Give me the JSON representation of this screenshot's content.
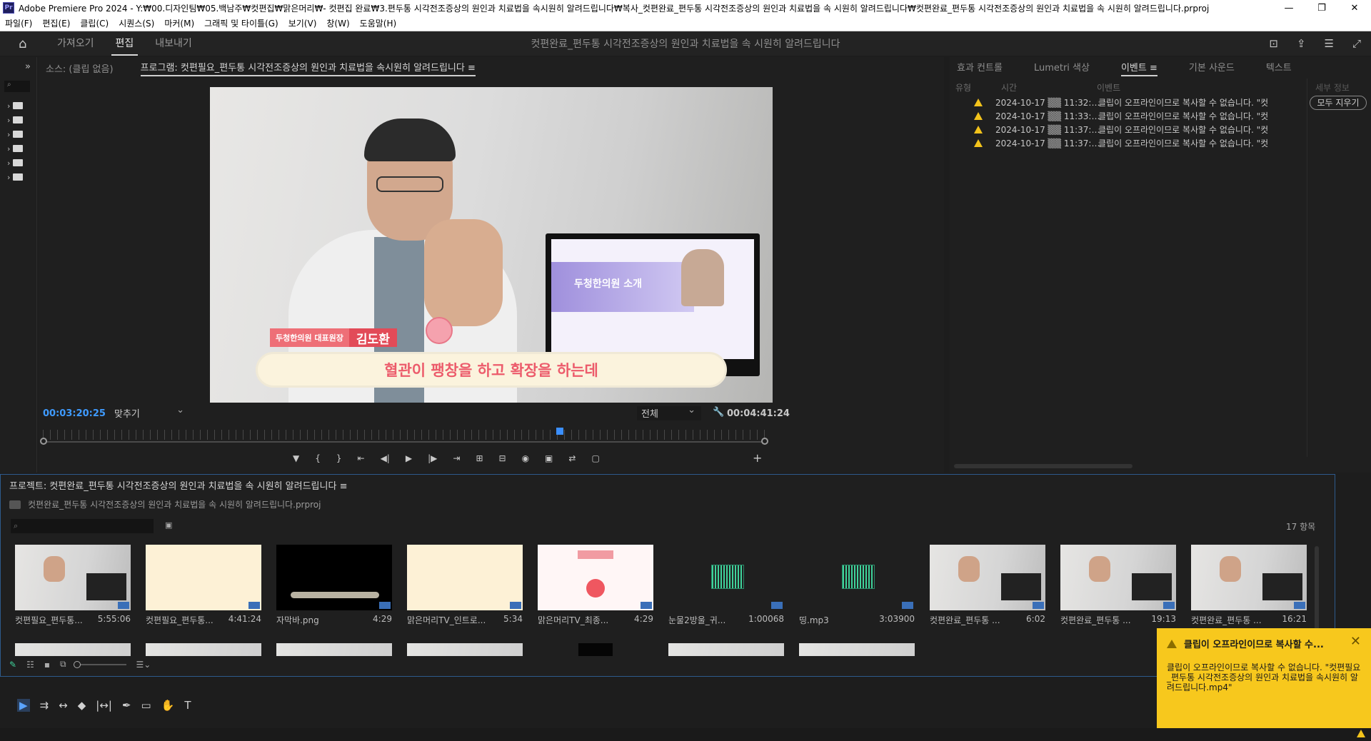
{
  "window": {
    "title": "Adobe Premiere Pro 2024 - Y:₩00.디자인팀₩05.백남주₩컷편집₩맑은머리₩- 컷편집 완료₩3.편두통 시각전조증상의 원인과 치료법을 속시원히 알려드립니다₩복사_컷편완료_편두통 시각전조증상의 원인과 치료법을 속 시원히 알려드립니다₩컷편완료_편두통 시각전조증상의 원인과 치료법을 속 시원히 알려드립니다.prproj",
    "logo": "Pr",
    "controls": [
      "—",
      "❐",
      "✕"
    ]
  },
  "menu": [
    "파일(F)",
    "편집(E)",
    "클립(C)",
    "시퀀스(S)",
    "마커(M)",
    "그래픽 및 타이틀(G)",
    "보기(V)",
    "창(W)",
    "도움말(H)"
  ],
  "workspace": {
    "tabs": [
      "가져오기",
      "편집",
      "내보내기"
    ],
    "active": "편집",
    "title": "컷편완료_편두통 시각전조증상의 원인과 치료법을 속 시원히 알려드립니다"
  },
  "program_monitor": {
    "source_tab": "소스: (클립 없음)",
    "program_tab": "프로그램: 컷편필요_편두통 시각전조증상의 원인과 치료법을 속시원히 알려드립니다",
    "menu_icon": "≡",
    "timecode_current": "00:03:20:25",
    "fit_label": "맞추기",
    "quality_label": "전체",
    "timecode_duration": "00:04:41:24",
    "playhead_fraction": 0.71,
    "video": {
      "lower_third_role": "두청한의원 대표원장",
      "lower_third_name": "김도환",
      "subtitle": "혈관이 팽창을 하고 확장을 하는데",
      "monitor_text": "두청한의원 소개"
    },
    "transport": [
      "▼",
      "{",
      "}",
      "⇤",
      "◀|",
      "▶",
      "|▶",
      "⇥",
      "⊞",
      "⊟",
      "◉",
      "▣",
      "⇄",
      "▢"
    ],
    "add": "+"
  },
  "events_panel": {
    "tabs": [
      "효과 컨트롤",
      "Lumetri 색상",
      "이벤트",
      "기본 사운드",
      "텍스트"
    ],
    "active": "이벤트",
    "col_type": "유형",
    "col_time": "시간",
    "col_event": "이벤트",
    "detail_head": "세부 정보",
    "clear_all": "모두 지우기",
    "rows": [
      {
        "time": "2024-10-17 ▒▒ 11:32:…",
        "msg": "클립이 오프라인이므로 복사할 수 없습니다. \"컷"
      },
      {
        "time": "2024-10-17 ▒▒ 11:33:…",
        "msg": "클립이 오프라인이므로 복사할 수 없습니다. \"컷"
      },
      {
        "time": "2024-10-17 ▒▒ 11:37:…",
        "msg": "클립이 오프라인이므로 복사할 수 없습니다. \"컷"
      },
      {
        "time": "2024-10-17 ▒▒ 11:37:…",
        "msg": "클립이 오프라인이므로 복사할 수 없습니다. \"컷"
      }
    ]
  },
  "project_panel": {
    "title": "프로젝트: 컷편완료_편두통 시각전조증상의 원인과 치료법을 속 시원히 알려드립니다",
    "path": "컷편완료_편두통 시각전조증상의 원인과 치료법을 속 시원히 알려드립니다.prproj",
    "search_placeholder": "",
    "item_count": "17 항목",
    "items": [
      {
        "name": "컷편필요_편두통...",
        "duration": "5:55:06",
        "kind": "video"
      },
      {
        "name": "컷편필요_편두통...",
        "duration": "4:41:24",
        "kind": "cream"
      },
      {
        "name": "자막바.png",
        "duration": "4:29",
        "kind": "black"
      },
      {
        "name": "맑은머리TV_인트로...",
        "duration": "5:34",
        "kind": "cream"
      },
      {
        "name": "맑은머리TV_최종...",
        "duration": "4:29",
        "kind": "pink"
      },
      {
        "name": "눈물2방울_귀...",
        "duration": "1:00068",
        "kind": "audio"
      },
      {
        "name": "띵.mp3",
        "duration": "3:03900",
        "kind": "audio"
      },
      {
        "name": "컷편완료_편두통 ...",
        "duration": "6:02",
        "kind": "video"
      },
      {
        "name": "컷편완료_편두통 ...",
        "duration": "19:13",
        "kind": "video"
      },
      {
        "name": "컷편완료_편두통 ...",
        "duration": "16:21",
        "kind": "video"
      }
    ]
  },
  "tools": [
    "▶",
    "⇉",
    "↔",
    "◆",
    "|↔|",
    "✒",
    "▭",
    "✋",
    "T"
  ],
  "toast": {
    "title": "클립이 오프라인이므로 복사할 수...",
    "close": "✕",
    "body": "클립이 오프라인이므로 복사할 수 없습니다. \"컷편필요_편두통 시각전조증상의 원인과 치료법을 속시원히 알려드립니다.mp4\""
  },
  "colors": {
    "accent_blue": "#3b8fff",
    "warning_yellow": "#f3c31b",
    "toast_bg": "#f7c81d",
    "subtitle_red": "#ec5b6b"
  }
}
